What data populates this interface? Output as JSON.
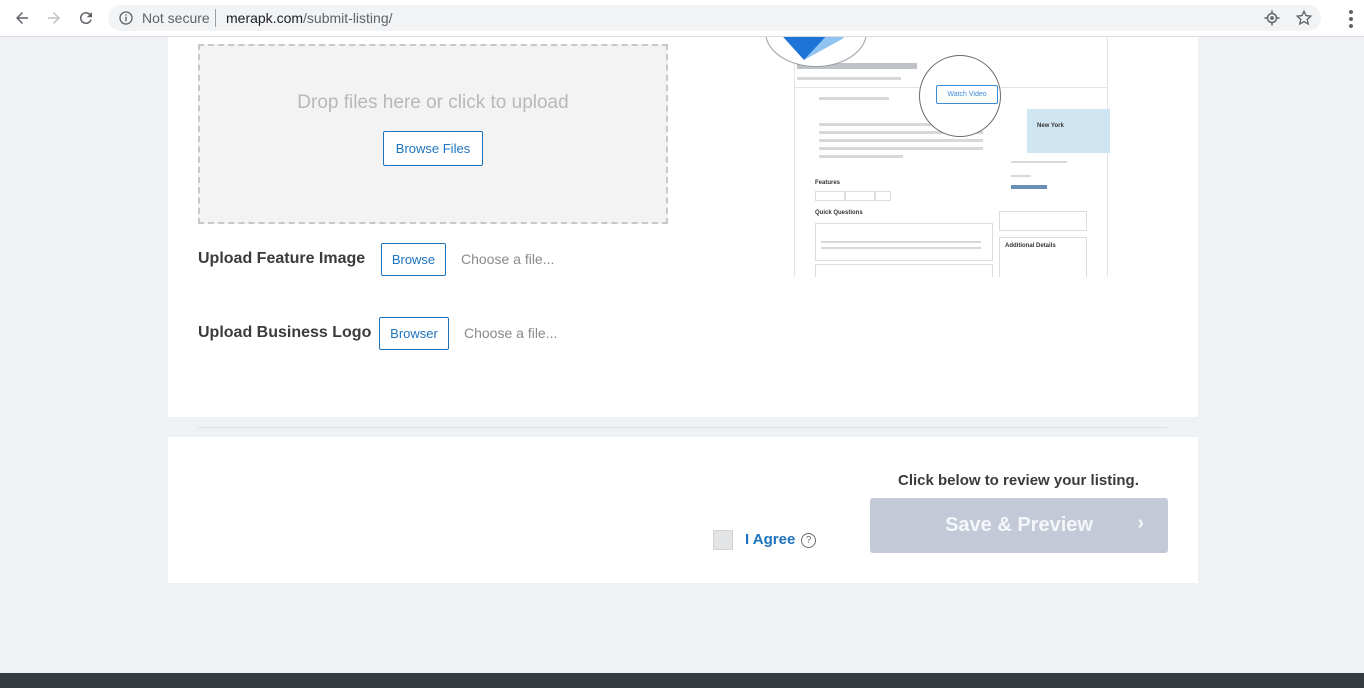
{
  "browser": {
    "security_label": "Not secure",
    "url_host": "merapk.com",
    "url_path": "/submit-listing/"
  },
  "dropzone": {
    "text": "Drop files here or click to upload",
    "button_label": "Browse Files"
  },
  "feature_image": {
    "label": "Upload Feature Image",
    "button_label": "Browse",
    "placeholder": "Choose a file..."
  },
  "business_logo": {
    "label": "Upload Business Logo",
    "button_label": "Browser",
    "placeholder": "Choose a file..."
  },
  "preview_mockup": {
    "watch_video_label": "Watch Video",
    "features_label": "Features",
    "quick_questions_label": "Quick Questions",
    "additional_details_label": "Additional Details",
    "map_label": "New York"
  },
  "review": {
    "prompt": "Click below to review your listing.",
    "save_label": "Save & Preview",
    "agree_label": "I Agree",
    "help_glyph": "?"
  },
  "colors": {
    "accent": "#1e73be",
    "save_button": "#c3c9d6",
    "page_bg": "#eff2f5",
    "footer": "#353b41"
  }
}
